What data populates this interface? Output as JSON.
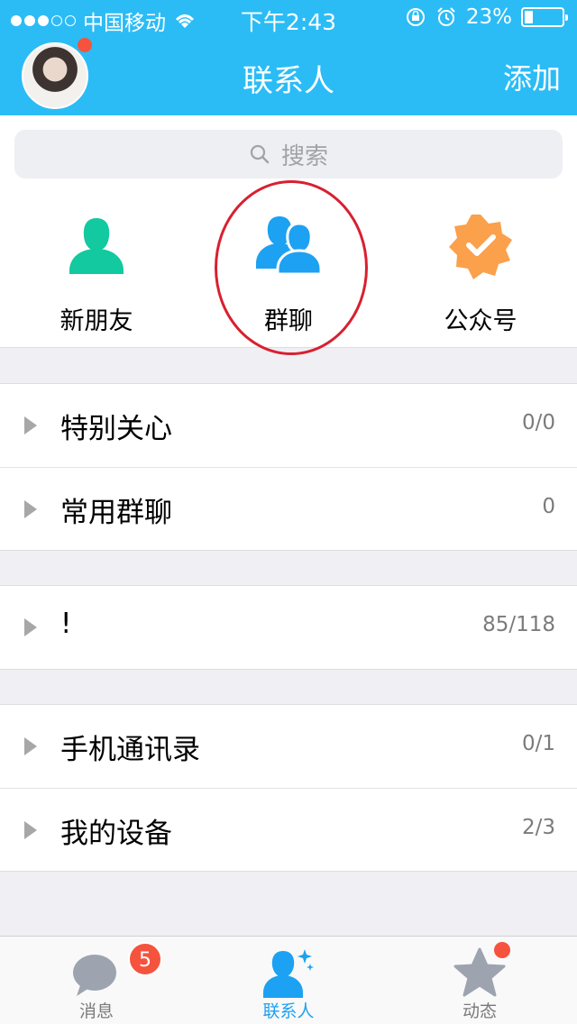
{
  "status_bar": {
    "carrier": "中国移动",
    "time": "下午2:43",
    "battery_text": "23%",
    "battery_level": 0.23,
    "signal_bars_filled": 3,
    "signal_bars_total": 5
  },
  "nav": {
    "title": "联系人",
    "add_label": "添加"
  },
  "search": {
    "placeholder": "搜索"
  },
  "quick_entries": [
    {
      "label": "新朋友",
      "icon": "person-icon",
      "color": "#12c9a0"
    },
    {
      "label": "群聊",
      "icon": "group-icon",
      "color": "#1da1f2"
    },
    {
      "label": "公众号",
      "icon": "verified-badge-icon",
      "color": "#fba04b"
    }
  ],
  "groups": [
    {
      "rows": [
        {
          "name": "特别关心",
          "count": "0/0"
        },
        {
          "name": "常用群聊",
          "count": "0"
        }
      ]
    },
    {
      "rows": [
        {
          "name": "!",
          "count": "85/118"
        }
      ]
    },
    {
      "rows": [
        {
          "name": "手机通讯录",
          "count": "0/1"
        },
        {
          "name": "我的设备",
          "count": "2/3"
        }
      ]
    }
  ],
  "tabbar": {
    "tabs": [
      {
        "label": "消息",
        "icon": "chat-bubble-icon",
        "badge": "5",
        "active": false
      },
      {
        "label": "联系人",
        "icon": "contacts-icon",
        "active": true
      },
      {
        "label": "动态",
        "icon": "star-icon",
        "active": false
      }
    ]
  },
  "colors": {
    "header_bg": "#2bbcf6",
    "accent_blue": "#1da1f2",
    "badge_red": "#f5533d",
    "highlight_circle": "#d8202f"
  }
}
